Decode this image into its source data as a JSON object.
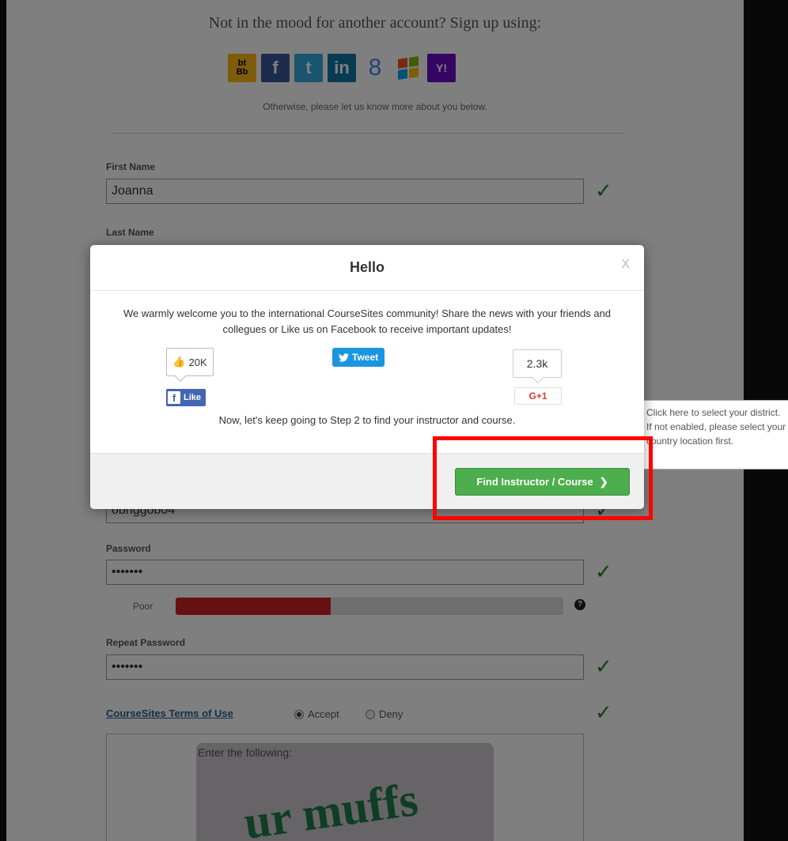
{
  "social": {
    "title": "Not in the mood for another account? Sign up using:",
    "subtitle": "Otherwise, please let us know more about you below.",
    "icons": [
      {
        "name": "blackboard-icon",
        "label": "bt Bb"
      },
      {
        "name": "facebook-icon",
        "label": "f"
      },
      {
        "name": "twitter-icon",
        "label": "t"
      },
      {
        "name": "linkedin-icon",
        "label": "in"
      },
      {
        "name": "google-icon",
        "label": "8"
      },
      {
        "name": "windows-icon",
        "label": ""
      },
      {
        "name": "yahoo-icon",
        "label": "Y!"
      }
    ]
  },
  "form": {
    "first_name_label": "First Name",
    "first_name_value": "Joanna",
    "last_name_label": "Last Name",
    "username_value": "obnggob04",
    "password_label": "Password",
    "password_value": "•••••••",
    "strength_label": "Poor",
    "strength_level": 0.4,
    "help_symbol": "?",
    "repeat_password_label": "Repeat Password",
    "repeat_password_value": "•••••••",
    "terms_link": "CourseSites Terms of Use",
    "accept_label": "Accept",
    "deny_label": "Deny",
    "captcha_label": "Enter the following:",
    "captcha_word": "ur muffs",
    "checkmark": "✓"
  },
  "tooltip": {
    "text": "Click here to select your district. If not enabled, please select your country location first."
  },
  "modal": {
    "title": "Hello",
    "close": "X",
    "message": "We warmly welcome you to the international CourseSites community! Share the news with your friends and collegues or Like us on Facebook to receive important updates!",
    "fb_count": "20K",
    "fb_like": "Like",
    "tweet": "Tweet",
    "gplus_count": "2.3k",
    "gplus_label": "G+1",
    "step_text": "Now, let's keep going to Step 2 to find your instructor and course.",
    "button": "Find Instructor / Course",
    "button_chevron": "❯"
  },
  "colors": {
    "accent_green": "#4cae4c",
    "highlight_red": "#ff0000",
    "link_blue": "#2a6090",
    "facebook_blue": "#4267b2",
    "twitter_blue": "#1b95e0"
  }
}
